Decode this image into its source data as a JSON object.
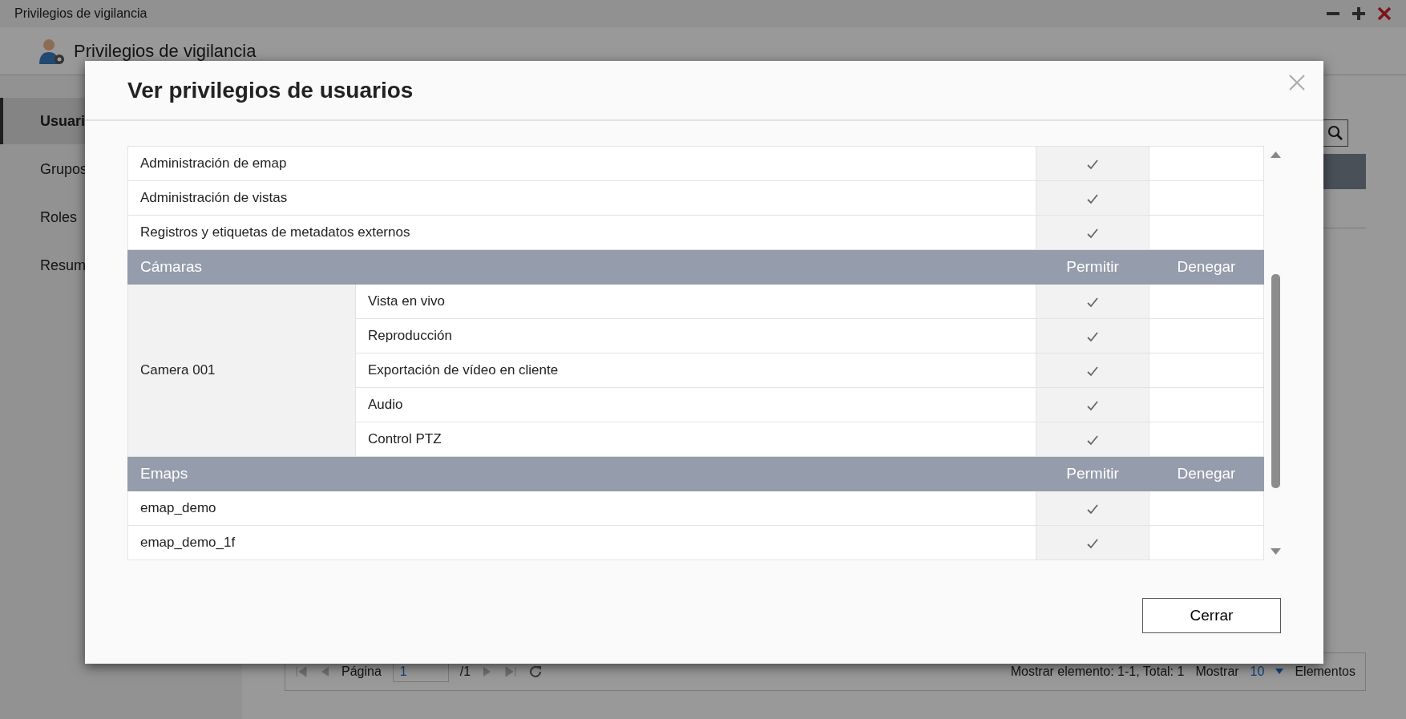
{
  "window": {
    "title": "Privilegios de vigilancia"
  },
  "app": {
    "header": "Privilegios de vigilancia"
  },
  "sidebar": {
    "items": [
      {
        "label": "Usuari",
        "selected": true
      },
      {
        "label": "Grupos",
        "selected": false
      },
      {
        "label": "Roles",
        "selected": false
      },
      {
        "label": "Resum",
        "selected": false
      }
    ]
  },
  "pagination": {
    "page_label": "Página",
    "page_value": "1",
    "page_total": "/1",
    "summary": "Mostrar elemento: 1-1, Total: 1",
    "show_label": "Mostrar",
    "page_size": "10",
    "items_label": "Elementos"
  },
  "dialog": {
    "title": "Ver privilegios de usuarios",
    "close_button": "Cerrar",
    "sections": [
      {
        "rows": [
          {
            "name": "Administración de emap",
            "allow": true,
            "deny": false
          },
          {
            "name": "Administración de vistas",
            "allow": true,
            "deny": false
          },
          {
            "name": "Registros y etiquetas de metadatos externos",
            "allow": true,
            "deny": false
          }
        ]
      },
      {
        "heading": "Cámaras",
        "columns": [
          "Permitir",
          "Denegar"
        ],
        "groups": [
          {
            "name": "Camera 001",
            "rows": [
              {
                "name": "Vista en vivo",
                "allow": true,
                "deny": false
              },
              {
                "name": "Reproducción",
                "allow": true,
                "deny": false
              },
              {
                "name": "Exportación de vídeo en cliente",
                "allow": true,
                "deny": false
              },
              {
                "name": "Audio",
                "allow": true,
                "deny": false
              },
              {
                "name": "Control PTZ",
                "allow": true,
                "deny": false
              }
            ]
          }
        ]
      },
      {
        "heading": "Emaps",
        "columns": [
          "Permitir",
          "Denegar"
        ],
        "rows": [
          {
            "name": "emap_demo",
            "allow": true,
            "deny": false
          },
          {
            "name": "emap_demo_1f",
            "allow": true,
            "deny": false
          }
        ]
      }
    ]
  }
}
